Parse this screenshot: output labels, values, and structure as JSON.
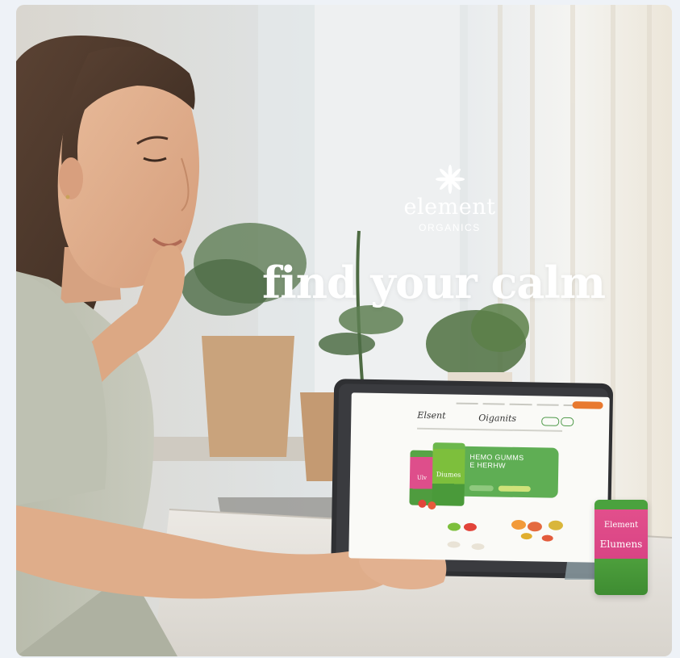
{
  "brand": {
    "name": "element",
    "sub": "ORGANICS"
  },
  "headline": "find your calm",
  "tablet_screen": {
    "logo_left": "Elsent",
    "logo_right": "Oiganits",
    "banner_text": "HEMO GUMMS\nE HERHW",
    "pack_front_label": "Diumes",
    "pack_back_label": "Ulv"
  },
  "product_bag": {
    "logo_text": "Element",
    "product_text": "Elumens"
  },
  "colors": {
    "brand_green": "#5fae54",
    "brand_pink": "#e24f8c",
    "accent_orange": "#e8792f",
    "headline_white": "#ffffff"
  }
}
